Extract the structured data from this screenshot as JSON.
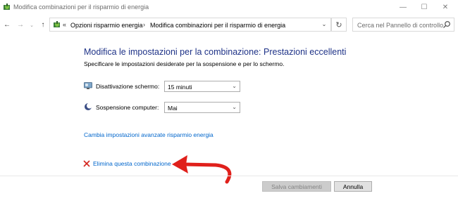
{
  "window": {
    "title": "Modifica combinazioni per il risparmio di energia",
    "minimize_glyph": "—",
    "maximize_glyph": "☐",
    "close_glyph": "✕"
  },
  "nav": {
    "back_glyph": "←",
    "forward_glyph": "→",
    "recent_glyph": "⌄",
    "up_glyph": "↑",
    "address_chevron": "«",
    "breadcrumbs": [
      "Opzioni risparmio energia",
      "Modifica combinazioni per il risparmio di energia"
    ],
    "breadcrumb_separator": "›",
    "dropdown_glyph": "⌄",
    "refresh_glyph": "↻",
    "search_placeholder": "Cerca nel Pannello di controllo"
  },
  "content": {
    "heading": "Modifica le impostazioni per la combinazione: Prestazioni eccellenti",
    "subheading": "Specificare le impostazioni desiderate per la sospensione e per lo schermo.",
    "settings": [
      {
        "label": "Disattivazione schermo:",
        "value": "15 minuti",
        "icon": "monitor-icon"
      },
      {
        "label": "Sospensione computer:",
        "value": "Mai",
        "icon": "moon-icon"
      }
    ],
    "advanced_link": "Cambia impostazioni avanzate risparmio energia",
    "delete_link": "Elimina questa combinazione"
  },
  "buttons": {
    "save": "Salva cambiamenti",
    "cancel": "Annulla"
  },
  "colors": {
    "heading": "#1e3287",
    "link": "#0066cc",
    "annotation_arrow": "#e0201b",
    "delete_icon": "#d4241c"
  }
}
